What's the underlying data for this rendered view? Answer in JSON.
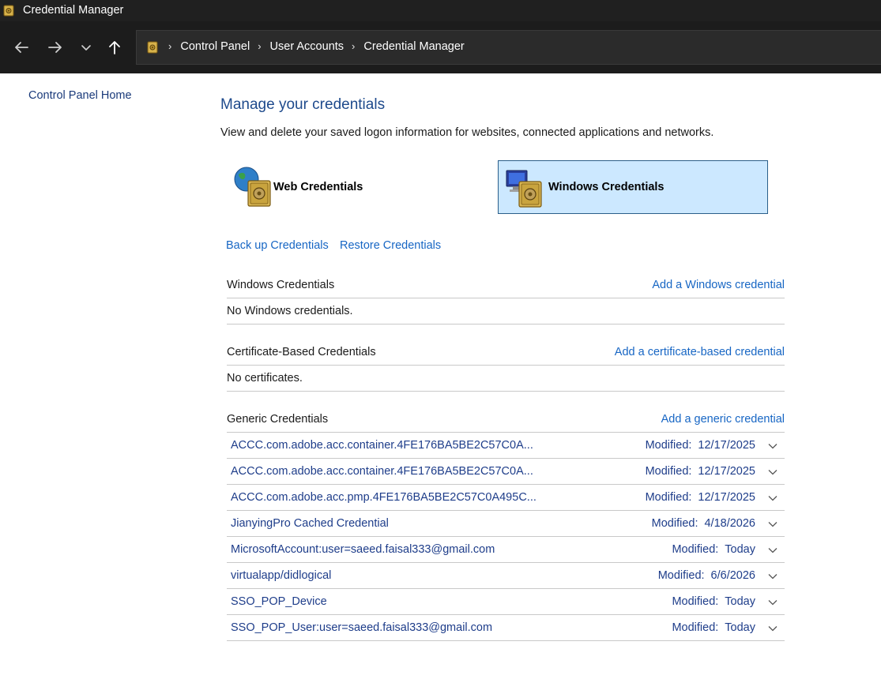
{
  "window": {
    "title": "Credential Manager"
  },
  "nav": {
    "back_icon": "arrow-left-icon",
    "forward_icon": "arrow-right-icon",
    "recent_icon": "chevron-down-icon",
    "up_icon": "arrow-up-icon",
    "breadcrumbs": [
      "Control Panel",
      "User Accounts",
      "Credential Manager"
    ]
  },
  "sidebar": {
    "home_link": "Control Panel Home"
  },
  "main": {
    "title": "Manage your credentials",
    "description": "View and delete your saved logon information for websites, connected applications and networks.",
    "tabs": [
      {
        "label": "Web Credentials",
        "icon": "globe-vault-icon",
        "selected": false
      },
      {
        "label": "Windows Credentials",
        "icon": "monitor-vault-icon",
        "selected": true
      }
    ],
    "backup_link": "Back up Credentials",
    "restore_link": "Restore Credentials",
    "windows_section": {
      "heading": "Windows Credentials",
      "add_link": "Add a Windows credential",
      "empty_text": "No Windows credentials."
    },
    "certificate_section": {
      "heading": "Certificate-Based Credentials",
      "add_link": "Add a certificate-based credential",
      "empty_text": "No certificates."
    },
    "generic_section": {
      "heading": "Generic Credentials",
      "add_link": "Add a generic credential",
      "modified_label": "Modified:",
      "items": [
        {
          "name": "ACCC.com.adobe.acc.container.4FE176BA5BE2C57C0A...",
          "modified": "12/17/2025"
        },
        {
          "name": "ACCC.com.adobe.acc.container.4FE176BA5BE2C57C0A...",
          "modified": "12/17/2025"
        },
        {
          "name": "ACCC.com.adobe.acc.pmp.4FE176BA5BE2C57C0A495C...",
          "modified": "12/17/2025"
        },
        {
          "name": "JianyingPro Cached Credential",
          "modified": "4/18/2026"
        },
        {
          "name": "MicrosoftAccount:user=saeed.faisal333@gmail.com",
          "modified": "Today"
        },
        {
          "name": "virtualapp/didlogical",
          "modified": "6/6/2026"
        },
        {
          "name": "SSO_POP_Device",
          "modified": "Today"
        },
        {
          "name": "SSO_POP_User:user=saeed.faisal333@gmail.com",
          "modified": "Today"
        }
      ]
    }
  },
  "colors": {
    "title_bar": "#202020",
    "nav_bar": "#1c1c1c",
    "link": "#1766c4",
    "heading": "#1e4a8c",
    "selected_tab": "#cce8ff"
  }
}
